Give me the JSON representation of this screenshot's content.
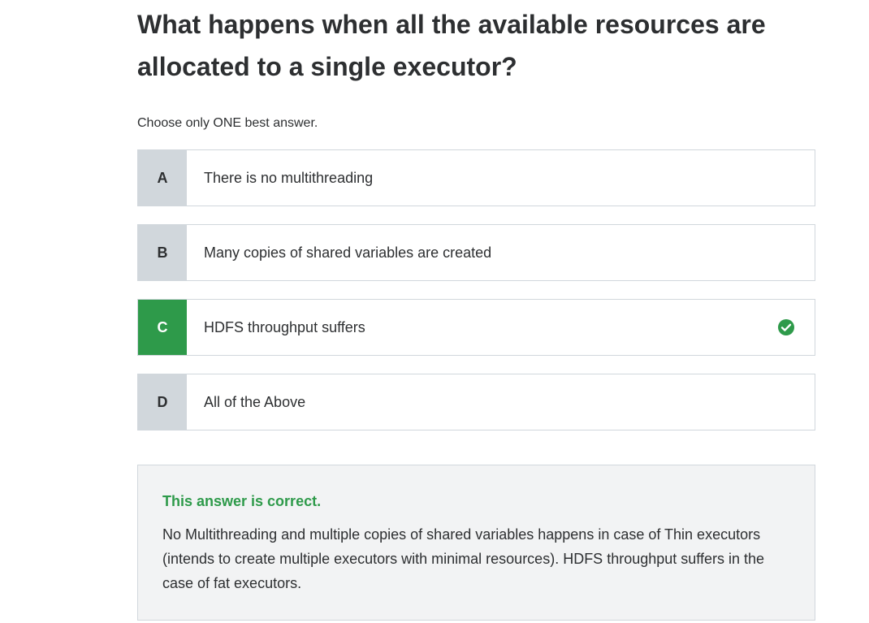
{
  "question": {
    "title": "What happens when all the available resources are allocated to a single executor?",
    "instruction": "Choose only ONE best answer."
  },
  "options": [
    {
      "letter": "A",
      "text": "There is no multithreading",
      "state": "default"
    },
    {
      "letter": "B",
      "text": "Many copies of shared variables are created",
      "state": "default"
    },
    {
      "letter": "C",
      "text": "HDFS throughput suffers",
      "state": "correct",
      "icon": "check-circle-icon"
    },
    {
      "letter": "D",
      "text": "All of the Above",
      "state": "default"
    }
  ],
  "feedback": {
    "title": "This answer is correct.",
    "body": "No Multithreading and multiple copies of shared variables happens in case of Thin executors (intends to create multiple executors with minimal resources). HDFS throughput suffers in the case of fat executors."
  },
  "colors": {
    "correct": "#2e9a4a",
    "letter_bg": "#d1d7dc",
    "feedback_bg": "#f2f3f4",
    "text": "#2d2f31"
  }
}
